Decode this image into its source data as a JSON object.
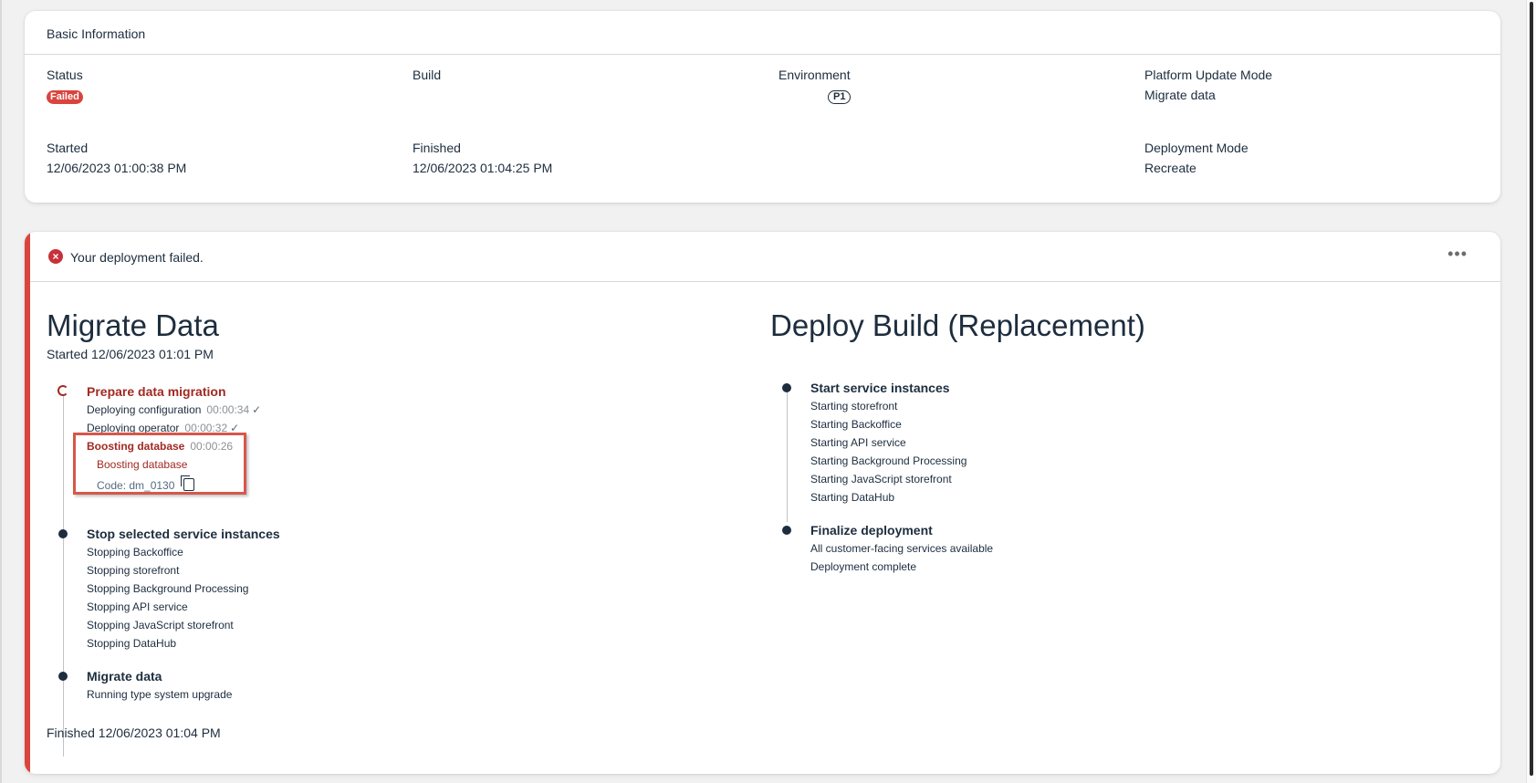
{
  "basic": {
    "header": "Basic Information",
    "fields": {
      "status": {
        "label": "Status",
        "value": "Failed"
      },
      "build": {
        "label": "Build",
        "value": ""
      },
      "environment": {
        "label": "Environment",
        "value": "P1"
      },
      "platform_update_mode": {
        "label": "Platform Update Mode",
        "value": "Migrate data"
      },
      "started": {
        "label": "Started",
        "value": "12/06/2023 01:00:38 PM"
      },
      "finished": {
        "label": "Finished",
        "value": "12/06/2023 01:04:25 PM"
      },
      "deployment_mode": {
        "label": "Deployment Mode",
        "value": "Recreate"
      }
    }
  },
  "deploy": {
    "message": "Your deployment failed.",
    "more_icon": "more-horizontal-icon",
    "migrate": {
      "title": "Migrate Data",
      "started": "Started 12/06/2023 01:01 PM",
      "finished": "Finished 12/06/2023 01:04 PM",
      "steps": [
        {
          "title": "Prepare data migration",
          "items": [
            {
              "label": "Deploying configuration",
              "duration": "00:00:34"
            },
            {
              "label": "Deploying operator",
              "duration": "00:00:32"
            }
          ],
          "error": {
            "title": "Boosting database",
            "duration": "00:00:26",
            "message": "Boosting database",
            "code": "Code: dm_0130"
          }
        },
        {
          "title": "Stop selected service instances",
          "items": [
            "Stopping Backoffice",
            "Stopping storefront",
            "Stopping Background Processing",
            "Stopping API service",
            "Stopping JavaScript storefront",
            "Stopping DataHub"
          ]
        },
        {
          "title": "Migrate data",
          "items": [
            "Running type system upgrade"
          ]
        }
      ]
    },
    "build": {
      "title": "Deploy Build (Replacement)",
      "steps": [
        {
          "title": "Start service instances",
          "items": [
            "Starting storefront",
            "Starting Backoffice",
            "Starting API service",
            "Starting Background Processing",
            "Starting JavaScript storefront",
            "Starting DataHub"
          ]
        },
        {
          "title": "Finalize deployment",
          "items": [
            "All customer-facing services available",
            "Deployment complete"
          ]
        }
      ]
    }
  },
  "colors": {
    "error": "#d9443d",
    "error_text": "#a12a22",
    "text": "#1d2d3e"
  }
}
